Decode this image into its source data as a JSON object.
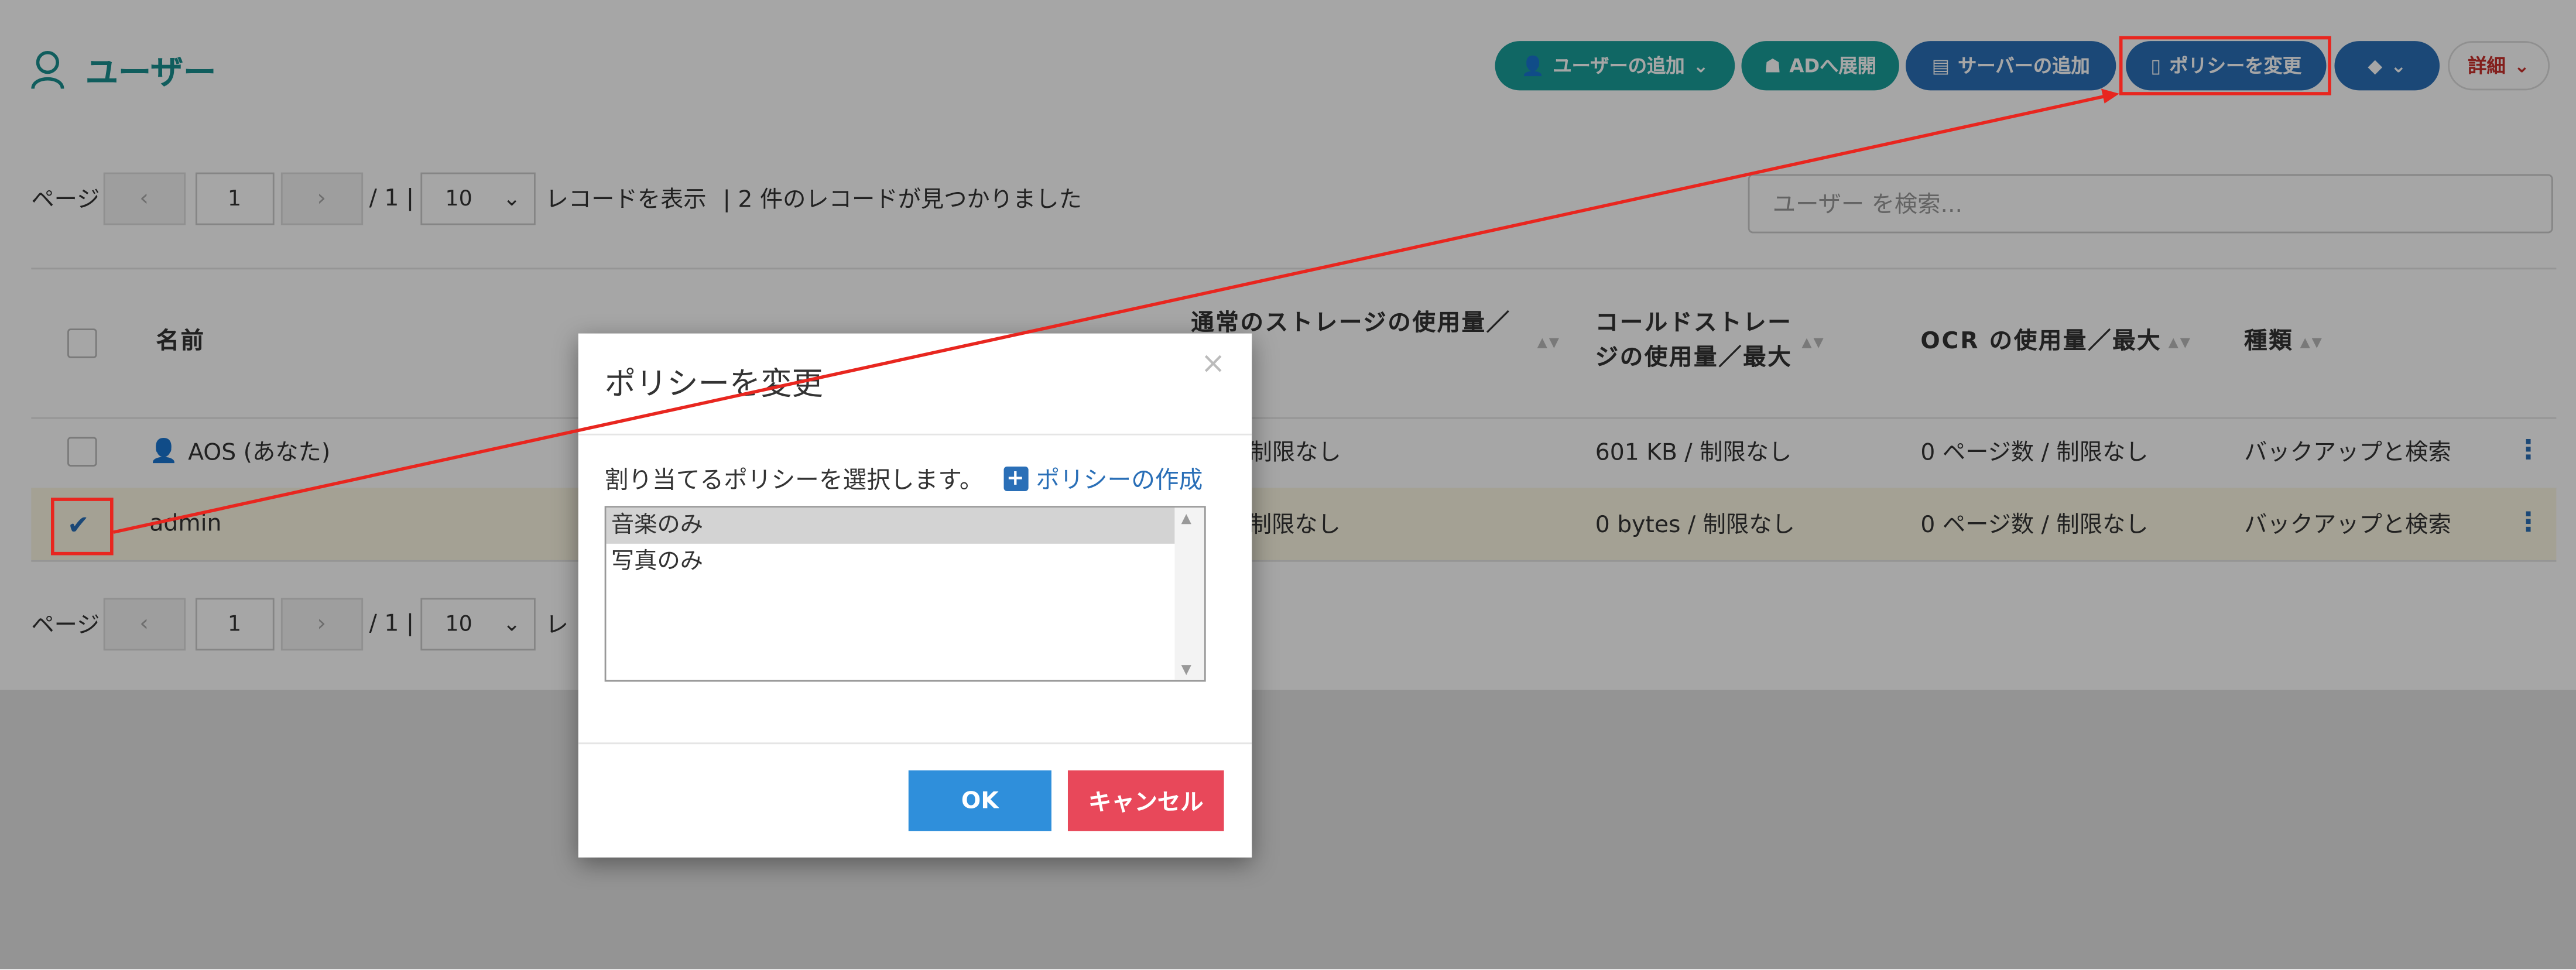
{
  "header": {
    "title": "ユーザー",
    "buttons": {
      "add_user": "ユーザーの追加",
      "ad_deploy": "ADへ展開",
      "add_server": "サーバーの追加",
      "change_policy": "ポリシーを変更",
      "details": "詳細"
    }
  },
  "pager": {
    "label": "ページ",
    "prev": "‹",
    "next": "›",
    "page": "1",
    "total": "/ 1 |",
    "page_size": "10",
    "records_label": "レコードを表示",
    "found": "| 2 件のレコードが見つかりました",
    "records_label_short": "レ"
  },
  "search": {
    "placeholder": "ユーザー を検索..."
  },
  "table": {
    "headers": {
      "name": "名前",
      "normal_storage": "通常のストレージの使用量／最大",
      "cold_storage": "コールドストレージの使用量／最大",
      "ocr": "OCR の使用量／最大",
      "type": "種類"
    },
    "rows": [
      {
        "name": "AOS (あなた)",
        "normal": "MB / 制限なし",
        "cold": "601 KB / 制限なし",
        "ocr": "0 ページ数 / 制限なし",
        "type": "バックアップと検索"
      },
      {
        "name": "admin",
        "normal": "tes / 制限なし",
        "cold": "0 bytes / 制限なし",
        "ocr": "0 ページ数 / 制限なし",
        "type": "バックアップと検索"
      }
    ]
  },
  "modal": {
    "title": "ポリシーを変更",
    "instruction": "割り当てるポリシーを選択します。",
    "create_link": "ポリシーの作成",
    "options": [
      "音楽のみ",
      "写真のみ"
    ],
    "ok": "OK",
    "cancel": "キャンセル"
  },
  "colors": {
    "teal": "#1a9e9a",
    "blue": "#2a6fb7",
    "highlight": "#e8261f",
    "ok": "#2f8fdb",
    "cancel": "#e8485a"
  }
}
